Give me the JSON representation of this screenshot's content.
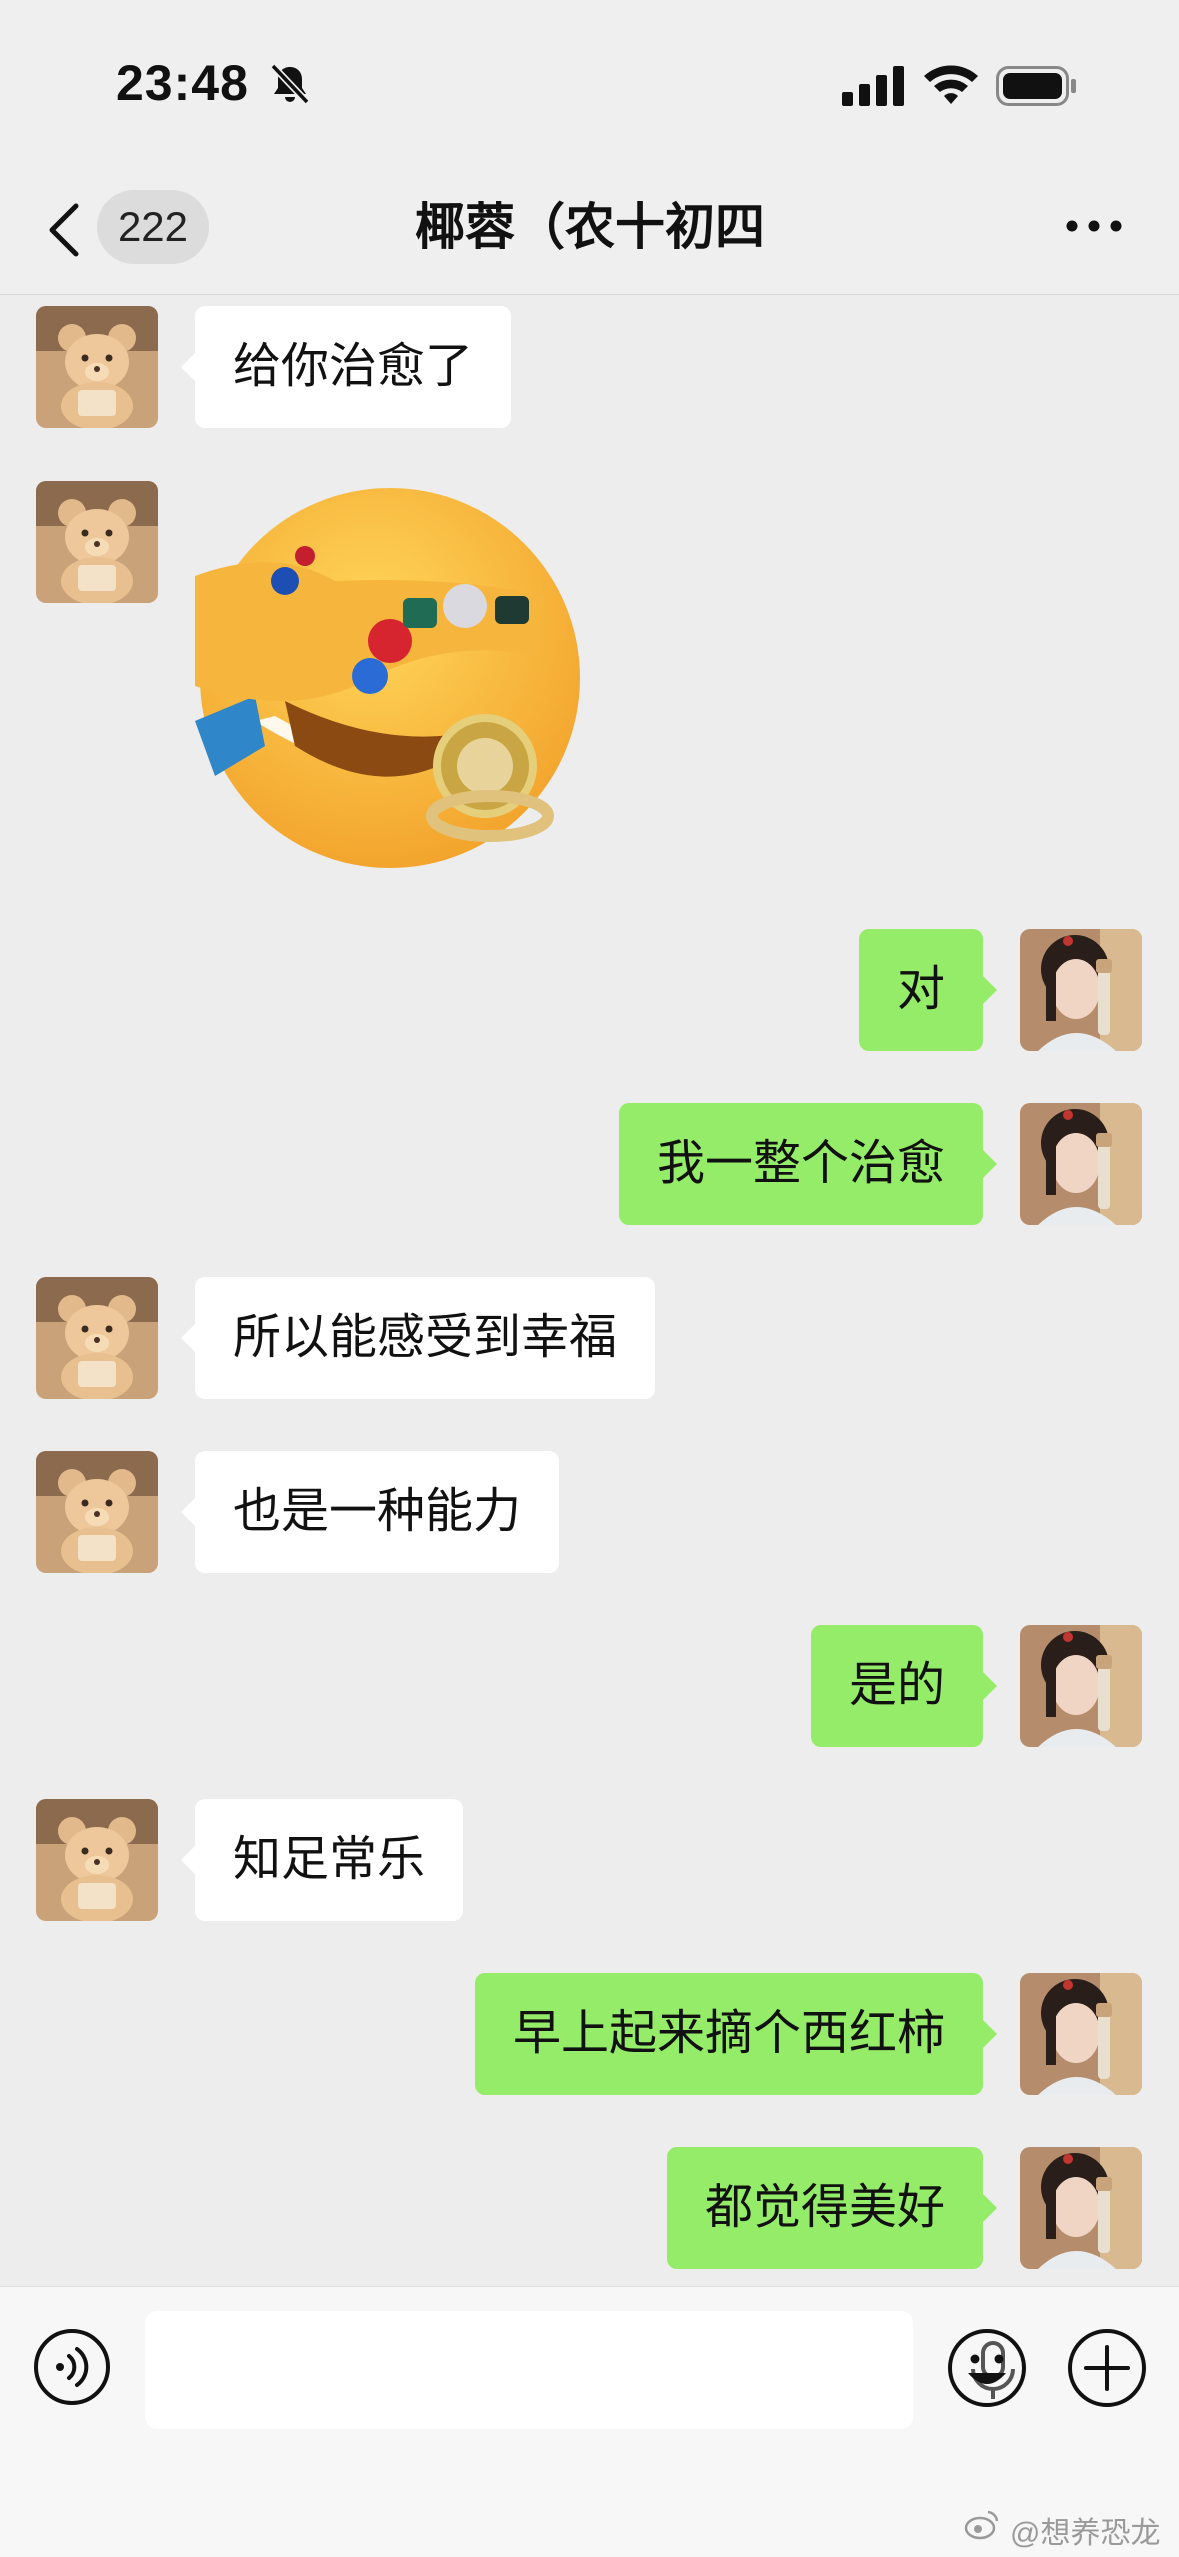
{
  "status_bar": {
    "time": "23:48",
    "mute": "bell-slash-icon"
  },
  "header": {
    "back_count": "222",
    "title": "椰蓉（农十初四"
  },
  "messages": [
    {
      "side": "in",
      "type": "text",
      "text": "给你治愈了"
    },
    {
      "side": "in",
      "type": "sticker",
      "description": "emoji-rings-watch-sticker"
    },
    {
      "side": "out",
      "type": "text",
      "text": "对"
    },
    {
      "side": "out",
      "type": "text",
      "text": "我一整个治愈"
    },
    {
      "side": "in",
      "type": "text",
      "text": "所以能感受到幸福"
    },
    {
      "side": "in",
      "type": "text",
      "text": "也是一种能力"
    },
    {
      "side": "out",
      "type": "text",
      "text": "是的"
    },
    {
      "side": "in",
      "type": "text",
      "text": "知足常乐"
    },
    {
      "side": "out",
      "type": "text",
      "text": "早上起来摘个西红柿"
    },
    {
      "side": "out",
      "type": "text",
      "text": "都觉得美好"
    }
  ],
  "input": {
    "value": "",
    "placeholder": ""
  },
  "watermark": "@想养恐龙",
  "colors": {
    "background": "#ededed",
    "outgoing_bubble": "#95ec69",
    "incoming_bubble": "#ffffff"
  }
}
